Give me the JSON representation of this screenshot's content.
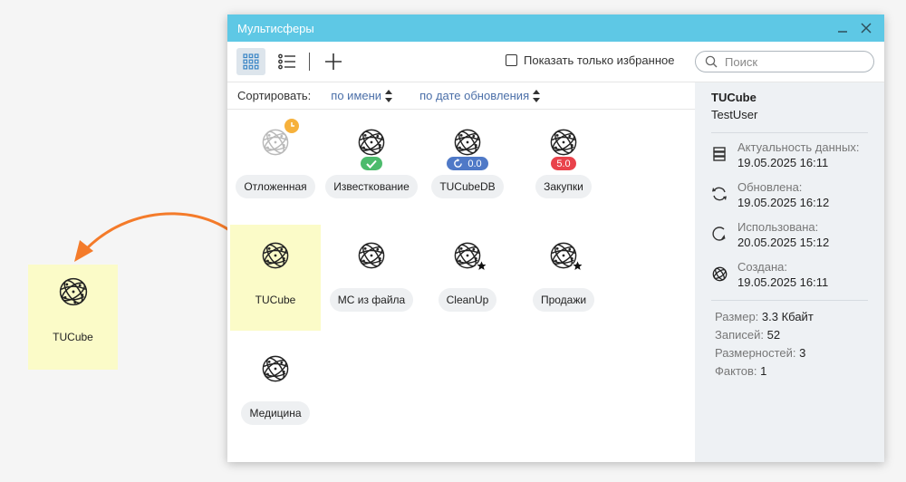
{
  "window": {
    "title": "Мультисферы"
  },
  "toolbar": {
    "favorites_label": "Показать только избранное",
    "search_placeholder": "Поиск"
  },
  "sort": {
    "label": "Сортировать:",
    "by_name": "по имени",
    "by_date": "по дате обновления"
  },
  "tiles": [
    {
      "label": "Отложенная",
      "state": "deferred"
    },
    {
      "label": "Известкование",
      "badge": "✓",
      "badge_type": "ok"
    },
    {
      "label": "TUCubeDB",
      "badge": "0.0",
      "badge_type": "ver"
    },
    {
      "label": "Закупки",
      "badge": "5.0",
      "badge_type": "err"
    },
    {
      "label": "TUCube",
      "state": "selected"
    },
    {
      "label": "МС из файла"
    },
    {
      "label": "CleanUp",
      "favorite": true
    },
    {
      "label": "Продажи",
      "favorite": true
    },
    {
      "label": "Медицина"
    }
  ],
  "drag": {
    "label": "TUCube"
  },
  "details": {
    "name": "TUCube",
    "user": "TestUser",
    "actual_label": "Актуальность данных:",
    "actual_value": "19.05.2025 16:11",
    "updated_label": "Обновлена:",
    "updated_value": "19.05.2025 16:12",
    "used_label": "Использована:",
    "used_value": "20.05.2025 15:12",
    "created_label": "Создана:",
    "created_value": "19.05.2025 16:11",
    "size_label": "Размер:",
    "size_value": "3.3 Кбайт",
    "records_label": "Записей:",
    "records_value": "52",
    "dims_label": "Размерностей:",
    "dims_value": "3",
    "facts_label": "Фактов:",
    "facts_value": "1"
  },
  "colors": {
    "titlebar": "#5ec8e5",
    "selected": "#fbfbc8",
    "arrow": "#f47b2a",
    "badge_ok": "#4cbb6c",
    "badge_ver": "#4f79c7",
    "badge_err": "#e9424b"
  }
}
